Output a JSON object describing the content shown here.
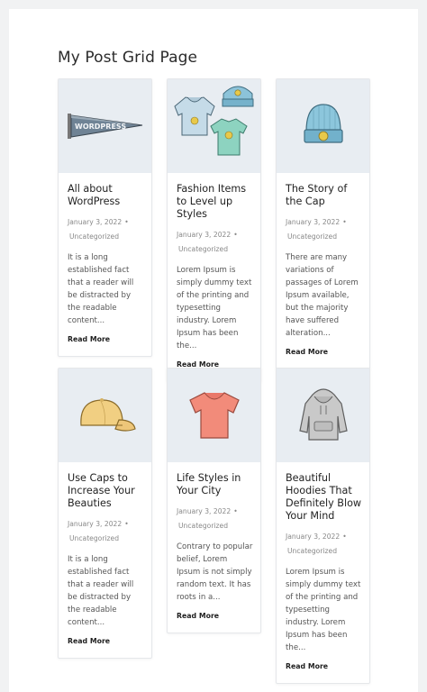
{
  "page": {
    "title": "My Post Grid Page"
  },
  "posts": [
    {
      "title": "All about WordPress",
      "date": "January 3, 2022",
      "category": "Uncategorized",
      "excerpt": "It is a long established fact that a reader will be distracted by the readable content...",
      "read_more": "Read More",
      "image_icon": "pennant-icon"
    },
    {
      "title": "Fashion Items to Level up Styles",
      "date": "January 3, 2022",
      "category": "Uncategorized",
      "excerpt": "Lorem Ipsum is simply dummy text of the printing and typesetting industry. Lorem Ipsum has been the...",
      "read_more": "Read More",
      "image_icon": "clothing-set-icon"
    },
    {
      "title": "The Story of the Cap",
      "date": "January 3, 2022",
      "category": "Uncategorized",
      "excerpt": "There are many variations of passages of Lorem Ipsum available, but the majority have suffered alteration...",
      "read_more": "Read More",
      "image_icon": "beanie-icon"
    },
    {
      "title": "Use Caps to Increase Your Beauties",
      "date": "January 3, 2022",
      "category": "Uncategorized",
      "excerpt": "It is a long established fact that a reader will be distracted by the readable content...",
      "read_more": "Read More",
      "image_icon": "cap-icon"
    },
    {
      "title": "Life Styles in Your City",
      "date": "January 3, 2022",
      "category": "Uncategorized",
      "excerpt": "Contrary to popular belief, Lorem Ipsum is not simply random text. It has roots in a...",
      "read_more": "Read More",
      "image_icon": "tshirt-icon"
    },
    {
      "title": "Beautiful Hoodies That Definitely Blow Your Mind",
      "date": "January 3, 2022",
      "category": "Uncategorized",
      "excerpt": "Lorem Ipsum is simply dummy text of the printing and typesetting industry. Lorem Ipsum has been the...",
      "read_more": "Read More",
      "image_icon": "hoodie-icon"
    }
  ],
  "pennant_text": "WORDPRESS"
}
